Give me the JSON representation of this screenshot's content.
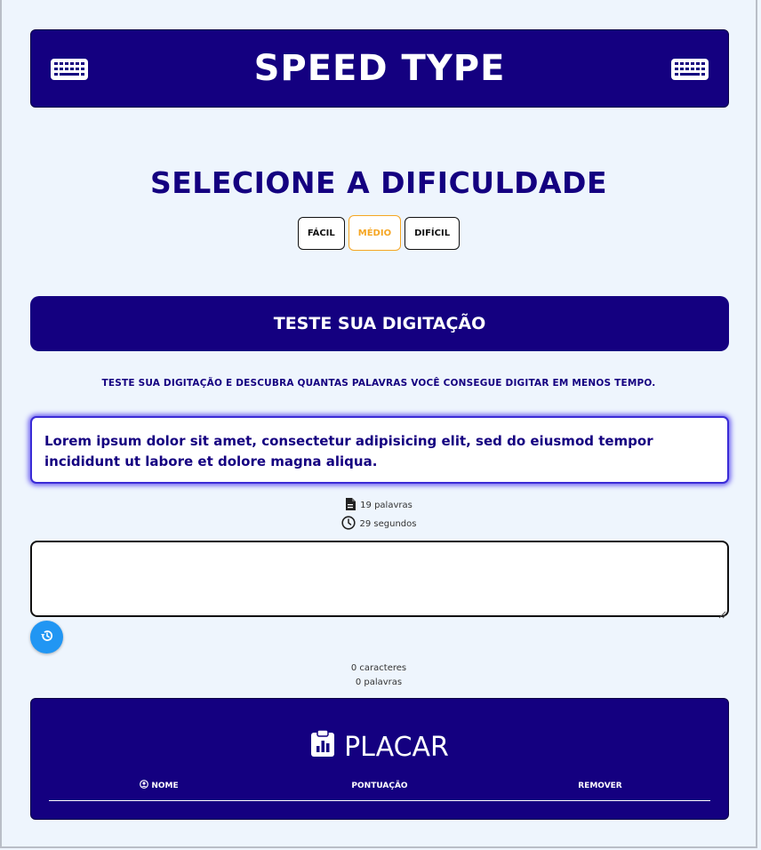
{
  "header": {
    "title": "SPEED TYPE"
  },
  "difficulty": {
    "title": "SELECIONE A DIFICULDADE",
    "options": [
      "FÁCIL",
      "MÉDIO",
      "DIFÍCIL"
    ],
    "selected": "MÉDIO"
  },
  "test": {
    "banner": "TESTE SUA DIGITAÇÃO",
    "subtitle": "TESTE SUA DIGITAÇÃO E DESCUBRA QUANTAS PALAVRAS VOCÊ CONSEGUE DIGITAR EM MENOS TEMPO.",
    "quote": "Lorem ipsum dolor sit amet, consectetur adipisicing elit, sed do eiusmod tempor incididunt ut labore et dolore magna aliqua.",
    "word_count": "19 palavras",
    "time": "29 segundos",
    "input_value": ""
  },
  "counters": {
    "characters": "0 caracteres",
    "words": "0 palavras"
  },
  "placar": {
    "title": "PLACAR",
    "columns": [
      "NOME",
      "PONTUAÇÃO",
      "REMOVER"
    ]
  },
  "colors": {
    "primary": "#140080",
    "accent": "#f5a623",
    "button_blue": "#2196f3",
    "background": "#eef5fd"
  },
  "icons": [
    "keyboard-icon",
    "document-icon",
    "clock-icon",
    "history-icon",
    "clipboard-chart-icon",
    "user-circle-icon"
  ]
}
